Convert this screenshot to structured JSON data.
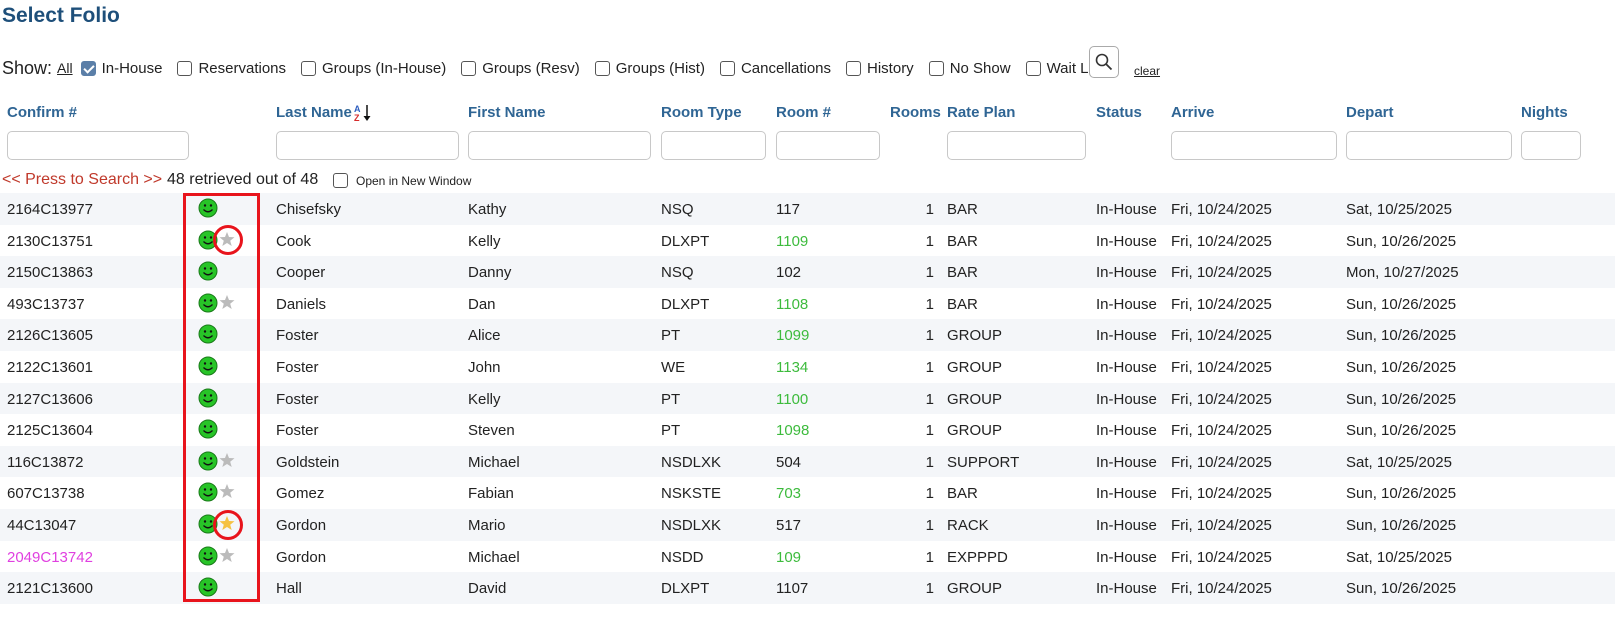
{
  "page_title": "Select Folio",
  "filters": {
    "show_label": "Show:",
    "all_label": "All",
    "options": [
      {
        "label": "In-House",
        "checked": true
      },
      {
        "label": "Reservations",
        "checked": false
      },
      {
        "label": "Groups (In-House)",
        "checked": false
      },
      {
        "label": "Groups (Resv)",
        "checked": false
      },
      {
        "label": "Groups (Hist)",
        "checked": false
      },
      {
        "label": "Cancellations",
        "checked": false
      },
      {
        "label": "History",
        "checked": false
      },
      {
        "label": "No Show",
        "checked": false
      },
      {
        "label": "Wait List",
        "checked": false
      }
    ],
    "search_icon": "search-icon",
    "clear_label": "clear"
  },
  "columns": {
    "confirm": "Confirm #",
    "last_name": "Last Name",
    "first_name": "First Name",
    "room_type": "Room Type",
    "room_no": "Room #",
    "rooms": "Rooms",
    "rate_plan": "Rate Plan",
    "status": "Status",
    "arrive": "Arrive",
    "depart": "Depart",
    "nights": "Nights"
  },
  "sort": {
    "column": "last_name",
    "icon": "sort-az-icon"
  },
  "search_bar": {
    "press_label": "<< Press to Search >>",
    "retrieved_text": "48 retrieved out of 48",
    "new_window_label": "Open in New Window",
    "new_window_checked": false
  },
  "colors": {
    "title": "#1e4f7a",
    "header": "#2f6594",
    "room_available": "#3dbb3d",
    "vip_confirm": "#e040e0",
    "highlight": "#e8141c",
    "star_gold": "#f5c242",
    "star_gray": "#bbbbbb"
  },
  "rows": [
    {
      "confirm": "2164C13977",
      "last": "Chisefsky",
      "first": "Kathy",
      "room_type": "NSQ",
      "room": "117",
      "room_green": false,
      "rooms": "1",
      "rate": "BAR",
      "status": "In-House",
      "arrive": "Fri, 10/24/2025",
      "depart": "Sat, 10/25/2025",
      "star": "none",
      "vip": false,
      "circled": false
    },
    {
      "confirm": "2130C13751",
      "last": "Cook",
      "first": "Kelly",
      "room_type": "DLXPT",
      "room": "1109",
      "room_green": true,
      "rooms": "1",
      "rate": "BAR",
      "status": "In-House",
      "arrive": "Fri, 10/24/2025",
      "depart": "Sun, 10/26/2025",
      "star": "gray",
      "vip": false,
      "circled": true
    },
    {
      "confirm": "2150C13863",
      "last": "Cooper",
      "first": "Danny",
      "room_type": "NSQ",
      "room": "102",
      "room_green": false,
      "rooms": "1",
      "rate": "BAR",
      "status": "In-House",
      "arrive": "Fri, 10/24/2025",
      "depart": "Mon, 10/27/2025",
      "star": "none",
      "vip": false,
      "circled": false
    },
    {
      "confirm": "493C13737",
      "last": "Daniels",
      "first": "Dan",
      "room_type": "DLXPT",
      "room": "1108",
      "room_green": true,
      "rooms": "1",
      "rate": "BAR",
      "status": "In-House",
      "arrive": "Fri, 10/24/2025",
      "depart": "Sun, 10/26/2025",
      "star": "gray",
      "vip": false,
      "circled": false
    },
    {
      "confirm": "2126C13605",
      "last": "Foster",
      "first": "Alice",
      "room_type": "PT",
      "room": "1099",
      "room_green": true,
      "rooms": "1",
      "rate": "GROUP",
      "status": "In-House",
      "arrive": "Fri, 10/24/2025",
      "depart": "Sun, 10/26/2025",
      "star": "none",
      "vip": false,
      "circled": false
    },
    {
      "confirm": "2122C13601",
      "last": "Foster",
      "first": "John",
      "room_type": "WE",
      "room": "1134",
      "room_green": true,
      "rooms": "1",
      "rate": "GROUP",
      "status": "In-House",
      "arrive": "Fri, 10/24/2025",
      "depart": "Sun, 10/26/2025",
      "star": "none",
      "vip": false,
      "circled": false
    },
    {
      "confirm": "2127C13606",
      "last": "Foster",
      "first": "Kelly",
      "room_type": "PT",
      "room": "1100",
      "room_green": true,
      "rooms": "1",
      "rate": "GROUP",
      "status": "In-House",
      "arrive": "Fri, 10/24/2025",
      "depart": "Sun, 10/26/2025",
      "star": "none",
      "vip": false,
      "circled": false
    },
    {
      "confirm": "2125C13604",
      "last": "Foster",
      "first": "Steven",
      "room_type": "PT",
      "room": "1098",
      "room_green": true,
      "rooms": "1",
      "rate": "GROUP",
      "status": "In-House",
      "arrive": "Fri, 10/24/2025",
      "depart": "Sun, 10/26/2025",
      "star": "none",
      "vip": false,
      "circled": false
    },
    {
      "confirm": "116C13872",
      "last": "Goldstein",
      "first": "Michael",
      "room_type": "NSDLXK",
      "room": "504",
      "room_green": false,
      "rooms": "1",
      "rate": "SUPPORT",
      "status": "In-House",
      "arrive": "Fri, 10/24/2025",
      "depart": "Sat, 10/25/2025",
      "star": "gray",
      "vip": false,
      "circled": false
    },
    {
      "confirm": "607C13738",
      "last": "Gomez",
      "first": "Fabian",
      "room_type": "NSKSTE",
      "room": "703",
      "room_green": true,
      "rooms": "1",
      "rate": "BAR",
      "status": "In-House",
      "arrive": "Fri, 10/24/2025",
      "depart": "Sun, 10/26/2025",
      "star": "gray",
      "vip": false,
      "circled": false
    },
    {
      "confirm": "44C13047",
      "last": "Gordon",
      "first": "Mario",
      "room_type": "NSDLXK",
      "room": "517",
      "room_green": false,
      "rooms": "1",
      "rate": "RACK",
      "status": "In-House",
      "arrive": "Fri, 10/24/2025",
      "depart": "Sun, 10/26/2025",
      "star": "gold",
      "vip": false,
      "circled": true
    },
    {
      "confirm": "2049C13742",
      "last": "Gordon",
      "first": "Michael",
      "room_type": "NSDD",
      "room": "109",
      "room_green": true,
      "rooms": "1",
      "rate": "EXPPPD",
      "status": "In-House",
      "arrive": "Fri, 10/24/2025",
      "depart": "Sat, 10/25/2025",
      "star": "gray",
      "vip": true,
      "circled": false
    },
    {
      "confirm": "2121C13600",
      "last": "Hall",
      "first": "David",
      "room_type": "DLXPT",
      "room": "1107",
      "room_green": false,
      "rooms": "1",
      "rate": "GROUP",
      "status": "In-House",
      "arrive": "Fri, 10/24/2025",
      "depart": "Sun, 10/26/2025",
      "star": "none",
      "vip": false,
      "circled": false
    }
  ]
}
